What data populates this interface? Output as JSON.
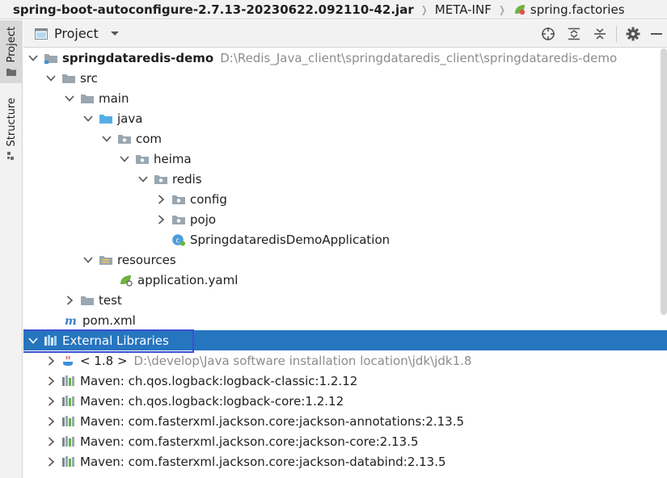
{
  "breadcrumb": {
    "jar": "spring-boot-autoconfigure-2.7.13-20230622.092110-42.jar",
    "folder": "META-INF",
    "file": "spring.factories"
  },
  "tool_strip": {
    "project_tab": "Project",
    "structure_tab": "Structure"
  },
  "panel": {
    "title": "Project"
  },
  "tree": {
    "root_name": "springdataredis-demo",
    "root_path": "D:\\Redis_Java_client\\springdataredis_client\\springdataredis-demo",
    "src": "src",
    "main": "main",
    "java": "java",
    "com": "com",
    "heima": "heima",
    "redis": "redis",
    "config": "config",
    "pojo": "pojo",
    "app_class": "SpringdataredisDemoApplication",
    "resources": "resources",
    "yaml": "application.yaml",
    "test": "test",
    "pom": "pom.xml",
    "external": "External Libraries",
    "jdk_name": "< 1.8 >",
    "jdk_path": "D:\\develop\\Java software installation location\\jdk\\jdk1.8",
    "libs": [
      "Maven: ch.qos.logback:logback-classic:1.2.12",
      "Maven: ch.qos.logback:logback-core:1.2.12",
      "Maven: com.fasterxml.jackson.core:jackson-annotations:2.13.5",
      "Maven: com.fasterxml.jackson.core:jackson-core:2.13.5",
      "Maven: com.fasterxml.jackson.core:jackson-databind:2.13.5"
    ]
  },
  "colors": {
    "selection": "#2675bf",
    "folder": "#9aa7b0",
    "source_folder": "#54aee6",
    "focus_border": "#3d4ed1"
  }
}
